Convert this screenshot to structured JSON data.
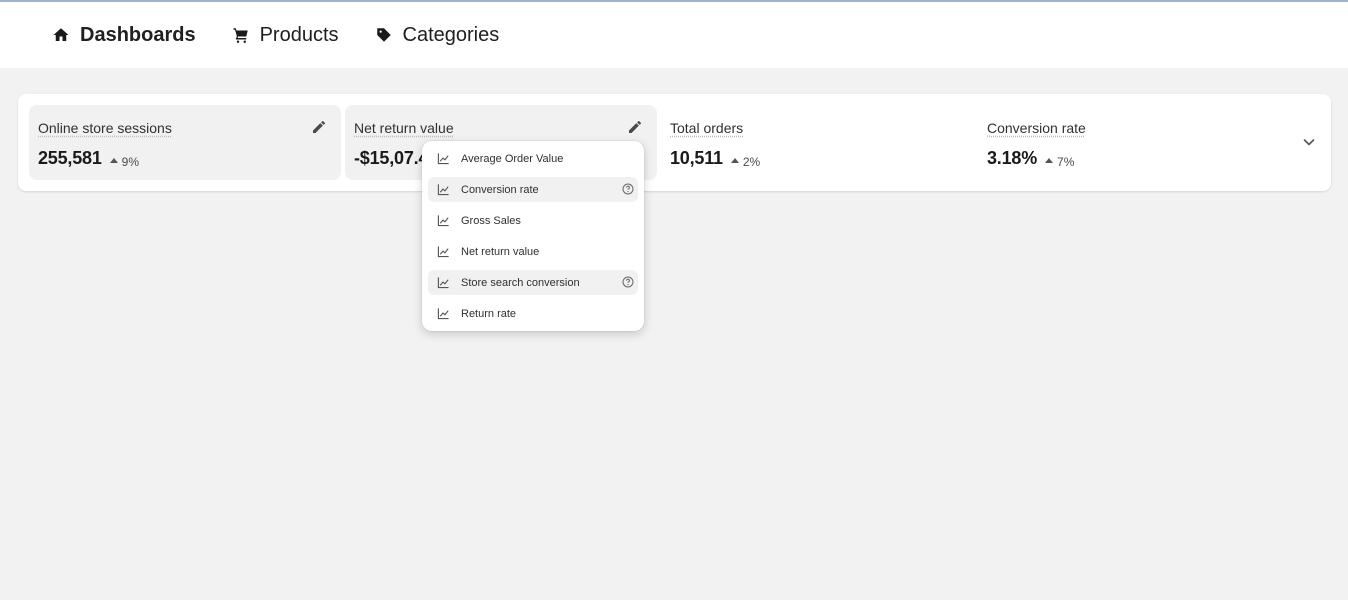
{
  "nav": {
    "items": [
      {
        "label": "Dashboards",
        "icon": "home-icon",
        "active": true
      },
      {
        "label": "Products",
        "icon": "cart-icon",
        "active": false
      },
      {
        "label": "Categories",
        "icon": "tag-icon",
        "active": false
      }
    ]
  },
  "metrics": [
    {
      "title": "Online store sessions",
      "value": "255,581",
      "change": "9%"
    },
    {
      "title": "Net return value",
      "value": "-$15,07.4",
      "change": ""
    },
    {
      "title": "Total orders",
      "value": "10,511",
      "change": "2%"
    },
    {
      "title": "Conversion rate",
      "value": "3.18%",
      "change": "7%"
    }
  ],
  "menu": {
    "items": [
      {
        "label": "Average Order Value"
      },
      {
        "label": "Conversion rate"
      },
      {
        "label": "Gross Sales"
      },
      {
        "label": "Net return value"
      },
      {
        "label": "Store search conversion"
      },
      {
        "label": "Return rate"
      }
    ]
  },
  "colors": {
    "page_bg": "#f2f2f2",
    "card_bg": "#ffffff",
    "highlight_bg": "#f1f1f1",
    "text": "#202020"
  }
}
